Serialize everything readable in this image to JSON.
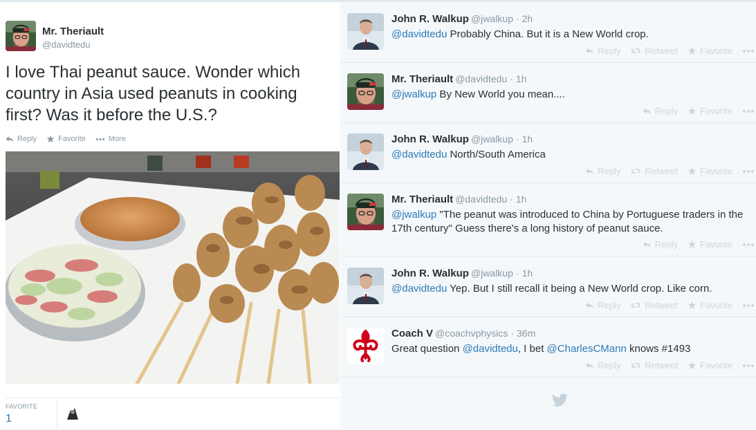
{
  "main": {
    "name": "Mr. Theriault",
    "handle": "@davidtedu",
    "text": "I love Thai peanut sauce. Wonder which country in Asia used peanuts in cooking first? Was it before the U.S.?",
    "actions": {
      "reply": "Reply",
      "favorite": "Favorite",
      "more": "More"
    },
    "stats": {
      "favorite_label": "FAVORITE",
      "favorite_count": "1"
    }
  },
  "replies": [
    {
      "avatar": "john",
      "name": "John R. Walkup",
      "handle": "@jwalkup",
      "time": "· 2h",
      "mention": "@davidtedu",
      "text": " Probably China.  But it is a New World crop.",
      "actions": [
        "Reply",
        "Retweet",
        "Favorite"
      ]
    },
    {
      "avatar": "theriault",
      "name": "Mr. Theriault",
      "handle": "@davidtedu",
      "time": "· 1h",
      "mention": "@jwalkup",
      "text": " By New World you mean....",
      "actions": [
        "Reply",
        "Favorite"
      ]
    },
    {
      "avatar": "john",
      "name": "John R. Walkup",
      "handle": "@jwalkup",
      "time": "· 1h",
      "mention": "@davidtedu",
      "text": " North/South America",
      "actions": [
        "Reply",
        "Retweet",
        "Favorite"
      ]
    },
    {
      "avatar": "theriault",
      "name": "Mr. Theriault",
      "handle": "@davidtedu",
      "time": "· 1h",
      "mention": "@jwalkup",
      "text": " \"The peanut was introduced to China by Portuguese traders in the",
      "text2": "17th century\" Guess there's a long history of peanut sauce.",
      "actions": [
        "Reply",
        "Favorite"
      ]
    },
    {
      "avatar": "john",
      "name": "John R. Walkup",
      "handle": "@jwalkup",
      "time": "· 1h",
      "mention": "@davidtedu",
      "text": " Yep. But I still recall it being a New World crop. Like corn.",
      "actions": [
        "Reply",
        "Retweet",
        "Favorite"
      ]
    },
    {
      "avatar": "coach",
      "name": "Coach V",
      "handle": "@coachvphysics",
      "time": "· 36m",
      "pre": "Great question ",
      "mention": "@davidtedu",
      "mid": ", I bet ",
      "mention2": "@CharlesCMann",
      "post": " knows #1493",
      "actions": [
        "Reply",
        "Retweet",
        "Favorite"
      ]
    }
  ],
  "icons": {
    "reply": "reply-icon",
    "retweet": "retweet-icon",
    "favorite": "star-icon",
    "more": "more-dots-icon",
    "twitter": "twitter-bird-icon"
  },
  "colors": {
    "link": "#2b7bb9",
    "muted": "#8899a6",
    "text": "#292f33",
    "coach_fleur": "#d0021b"
  }
}
